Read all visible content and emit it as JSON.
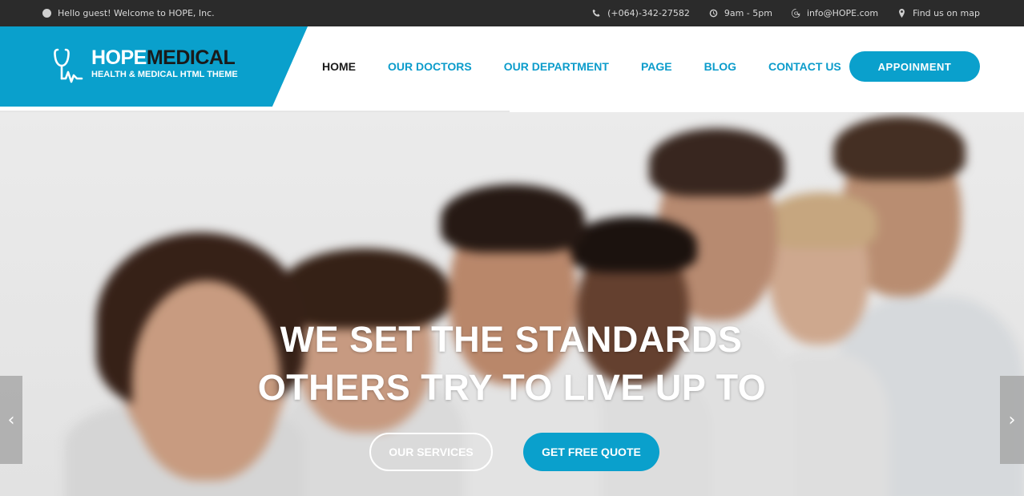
{
  "topbar": {
    "greeting": "Hello guest! Welcome to HOPE, Inc.",
    "phone": "(+064)-342-27582",
    "hours": "9am - 5pm",
    "email": "info@HOPE.com",
    "map": "Find us on map"
  },
  "brand": {
    "name_part1": "HOPE",
    "name_part2": "MEDICAL",
    "tagline": "HEALTH & MEDICAL HTML THEME"
  },
  "nav": {
    "items": [
      "HOME",
      "OUR DOCTORS",
      "OUR DEPARTMENT",
      "PAGE",
      "BLOG",
      "CONTACT US"
    ],
    "active": "HOME"
  },
  "appointment_label": "APPOINMENT",
  "hero": {
    "line1": "WE SET THE STANDARDS",
    "line2": "OTHERS TRY TO LIVE UP TO",
    "button_services": "OUR SERVICES",
    "button_quote": "GET FREE QUOTE",
    "prev_arrow": "‹",
    "next_arrow": "›"
  },
  "colors": {
    "accent": "#0aa0cc",
    "topbar_bg": "#2b2b2b",
    "nav_active": "#1a1a1a"
  }
}
